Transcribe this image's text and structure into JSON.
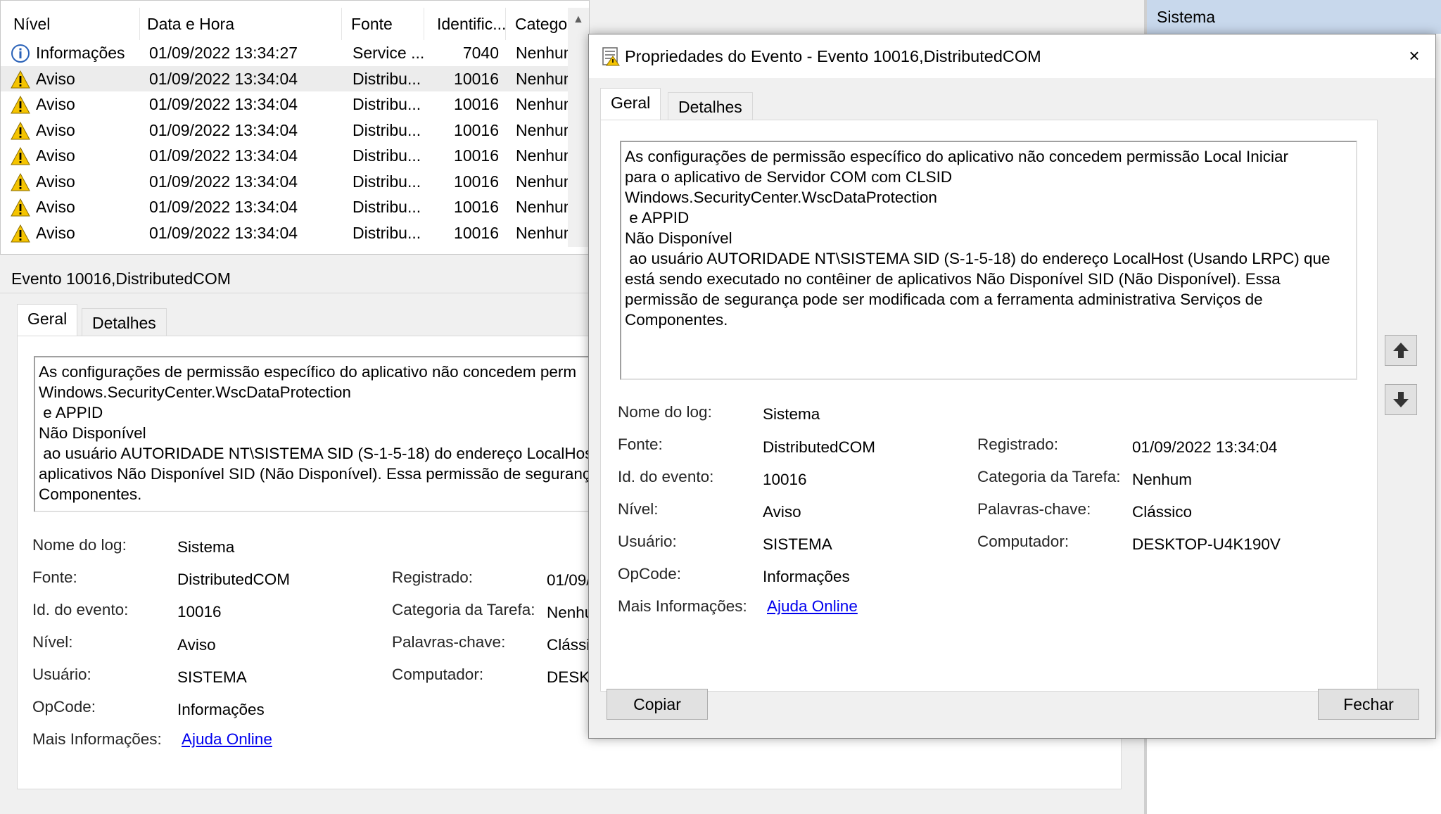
{
  "list": {
    "headers": [
      "Nível",
      "Data e Hora",
      "Fonte",
      "Identific...",
      "Catego..."
    ],
    "rows": [
      {
        "level": "Informações",
        "icon": "info-icon",
        "datetime": "01/09/2022 13:34:27",
        "source": "Service ...",
        "id": "7040",
        "category": "Nenhum"
      },
      {
        "level": "Aviso",
        "icon": "warning-icon",
        "datetime": "01/09/2022 13:34:04",
        "source": "Distribu...",
        "id": "10016",
        "category": "Nenhum"
      },
      {
        "level": "Aviso",
        "icon": "warning-icon",
        "datetime": "01/09/2022 13:34:04",
        "source": "Distribu...",
        "id": "10016",
        "category": "Nenhum"
      },
      {
        "level": "Aviso",
        "icon": "warning-icon",
        "datetime": "01/09/2022 13:34:04",
        "source": "Distribu...",
        "id": "10016",
        "category": "Nenhum"
      },
      {
        "level": "Aviso",
        "icon": "warning-icon",
        "datetime": "01/09/2022 13:34:04",
        "source": "Distribu...",
        "id": "10016",
        "category": "Nenhum"
      },
      {
        "level": "Aviso",
        "icon": "warning-icon",
        "datetime": "01/09/2022 13:34:04",
        "source": "Distribu...",
        "id": "10016",
        "category": "Nenhum"
      },
      {
        "level": "Aviso",
        "icon": "warning-icon",
        "datetime": "01/09/2022 13:34:04",
        "source": "Distribu...",
        "id": "10016",
        "category": "Nenhum"
      },
      {
        "level": "Aviso",
        "icon": "warning-icon",
        "datetime": "01/09/2022 13:34:04",
        "source": "Distribu...",
        "id": "10016",
        "category": "Nenhum"
      }
    ]
  },
  "right_panel": {
    "header": "Sistema"
  },
  "pane": {
    "title": "Evento 10016,DistributedCOM",
    "tabs": [
      "Geral",
      "Detalhes"
    ],
    "description": "As configurações de permissão específico do aplicativo não concedem perm\nWindows.SecurityCenter.WscDataProtection\n e APPID\nNão Disponível\n ao usuário AUTORIDADE NT\\SISTEMA SID (S-1-5-18) do endereço LocalHost\naplicativos Não Disponível SID (Não Disponível). Essa permissão de seguranç\nComponentes.",
    "fields": {
      "log_name_label": "Nome do log:",
      "log_name": "Sistema",
      "source_label": "Fonte:",
      "source": "DistributedCOM",
      "event_id_label": "Id. do evento:",
      "event_id": "10016",
      "level_label": "Nível:",
      "level": "Aviso",
      "user_label": "Usuário:",
      "user": "SISTEMA",
      "opcode_label": "OpCode:",
      "opcode": "Informações",
      "more_info_label": "Mais Informações:",
      "more_info_link": "Ajuda Online",
      "logged_label": "Registrado:",
      "logged": "01/09/",
      "task_category_label": "Categoria da Tarefa:",
      "task_category": "Nenhu",
      "keywords_label": "Palavras-chave:",
      "keywords": "Clássic",
      "computer_label": "Computador:",
      "computer": "DESKT"
    }
  },
  "dialog": {
    "title": "Propriedades do Evento - Evento 10016,DistributedCOM",
    "close_glyph": "×",
    "tabs": [
      "Geral",
      "Detalhes"
    ],
    "description": "As configurações de permissão específico do aplicativo não concedem permissão Local Iniciar\npara o aplicativo de Servidor COM com CLSID\nWindows.SecurityCenter.WscDataProtection\n e APPID\nNão Disponível\n ao usuário AUTORIDADE NT\\SISTEMA SID (S-1-5-18) do endereço LocalHost (Usando LRPC) que\nestá sendo executado no contêiner de aplicativos Não Disponível SID (Não Disponível). Essa\npermissão de segurança pode ser modificada com a ferramenta administrativa Serviços de\nComponentes.",
    "fields": {
      "log_name_label": "Nome do log:",
      "log_name": "Sistema",
      "source_label": "Fonte:",
      "source": "DistributedCOM",
      "event_id_label": "Id. do evento:",
      "event_id": "10016",
      "level_label": "Nível:",
      "level": "Aviso",
      "user_label": "Usuário:",
      "user": "SISTEMA",
      "opcode_label": "OpCode:",
      "opcode": "Informações",
      "more_info_label": "Mais Informações:",
      "more_info_link": "Ajuda Online",
      "logged_label": "Registrado:",
      "logged": "01/09/2022 13:34:04",
      "task_category_label": "Categoria da Tarefa:",
      "task_category": "Nenhum",
      "keywords_label": "Palavras-chave:",
      "keywords": "Clássico",
      "computer_label": "Computador:",
      "computer": "DESKTOP-U4K190V"
    },
    "copy_button": "Copiar",
    "close_button": "Fechar"
  },
  "colors": {
    "warning": "#f5c400",
    "info_blue": "#2a62b8",
    "link": "#0000ee",
    "selected_row": "#ececec",
    "right_header": "#c8d8ec"
  }
}
